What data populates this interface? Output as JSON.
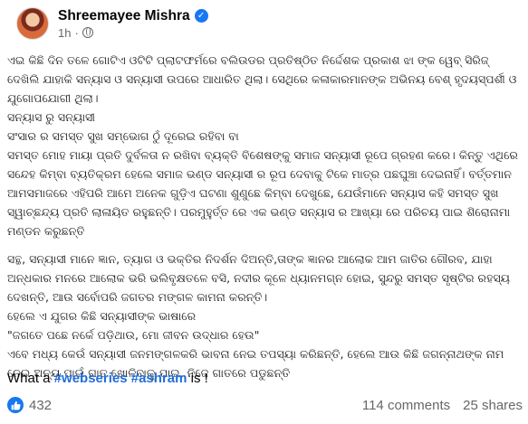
{
  "post": {
    "author": "Shreemayee Mishra",
    "time": "1h",
    "paragraphs": [
      "ଏଇ କିଛି ଦିନ ତଳେ ଗୋଟିଏ ଓଟିଟି ପ୍ଲାଟଫର୍ମରେ ବଲିଉଡର ପ୍ରତିଷ୍ଠିତ ନିର୍ଦ୍ଦେଶକ ପ୍ରକାଶ ଝା ଙ୍କ ୱେବ୍ ସିରିଜ୍ ଦେଖିଲି ଯାହାକି ସନ୍ୟାସ ଓ ସନ୍ୟାସୀ ଉପରେ ଆଧାରିତ ଥିଲା। ସେଥିରେ କଳାକାରମାନଙ୍କ ଅଭିନୟ ବେଶ୍ ହୃଦୟସ୍ପର୍ଶୀ ଓ ଯୁଗୋପଯୋଗୀ ଥିଲା।\nସନ୍ୟାସ ରୁ ସନ୍ୟାସୀ\nସଂସାର ର ସମସ୍ତ ସୁଖ ସମ୍ଭୋଗ ଠୁଁ ଦୂରେଇ ରହିବା ବା\nସମସ୍ତ ମୋହ ମାୟା ପ୍ରତି ଦୁର୍ବଳତା ନ ରଖିବା ବ୍ୟକ୍ତି ବିଶେଷଙ୍କୁ ସମାଜ ସନ୍ୟାସୀ ରୂପେ ଗ୍ରହଣ କରେ। କିନ୍ତୁ ଏଥିରେ ସନ୍ଦେହ କିମ୍ବା ବ୍ୟତିକ୍ରମ ହେଲେ ସମାଜ ଭଣ୍ଡ ସନ୍ୟାସୀ ର ରୂପ ଦେବାକୁ ଟିକେ ମାତ୍ର ପଛଘୁଞ୍ଚା ଦେଇନାହିଁ। ବର୍ତ୍ତମାନ ଆମସମାଜରେ ଏହିପରି ଆମେ ଅନେକ ଗୁଡ଼ିଏ ଘଟଣା ଶୁଣୁଛେ କିମ୍ବା ଦେଖୁଛେ, ଯେଉଁମାନେ ସନ୍ୟାସ କହି ସମସ୍ତ ସୁଖ ସ୍ୱାଚ୍ଛନ୍ଦ୍ୟ ପ୍ରତି ଲାଳାୟିତ ରହୁଛନ୍ତି। ପରମୁହୁର୍ତ୍ତ ରେ ଏକ ଭଣ୍ଡ ସନ୍ୟାସ ର ଆଖ୍ୟା ରେ ପରିଚୟ ପାଇ ଶିରୋନାମା ମଣ୍ଡନ କରୁଛନ୍ତି",
      "ସନ୍ଥ, ସନ୍ୟାସୀ ମାନେ ଜ୍ଞାନ, ତ୍ୟାଗ ଓ ଭକ୍ତିର ନିଦର୍ଶନ ଦିଅନ୍ତି,ତାଙ୍କ ଜ୍ଞାନର ଆଲୋକ ଆମ ଜାତିର ଗୌରବ, ଯାହା ଅନ୍ଧକାର ମନରେ ଆଲୋକ ଭରି ଭଲିବୃକ୍ଷତଳେ ବସି, ନଦୀର କୂଳେ ଧ୍ୟାନମଗ୍ନ ହୋଇ, ସୁନ୍ଦରୁ ସମସ୍ତ ସୃଷ୍ଟିର ରହସ୍ୟ ଦେଖନ୍ତି, ଆଉ ସର୍ବୋପରି ଜଗତର ମଙ୍ଗଳ କାମନା କରନ୍ତି।\nହେଲେ ଏ ଯୁଗର କିଛି ସନ୍ୟାସୀଙ୍କ ଭାଷାରେ\n\"ଜଗତେ ପଛେ ନର୍କେ ପଡ଼ିଥାଉ, ମୋ ଜୀବନ ଉଦ୍ଧାର ହେଉ\"\nଏବେ ମଧ୍ୟ କେଉଁ ସନ୍ୟାସୀ ଜନମଙ୍ଗଳକରି ଭାବନା ନେଇ ତପସ୍ୟା କରିଛନ୍ତି, ହେଲେ ଆଉ କିଛି ଜଗନ୍ନାଥଙ୍କ ନାମ ନେଇ ଅନ୍ୟ ପାଇଁ ଗାତ ଖୋଳିବାକୁ ଯାଇ, ନିଜେ ଗାତରେ ପଡୁଛନ୍ତି"
    ],
    "closing_prefix": "What a ",
    "hashtags": [
      "#webseries",
      "#ashram"
    ],
    "closing_suffix": " is !"
  },
  "footer": {
    "reactions_count": "432",
    "comments": "114 comments",
    "shares": "25 shares"
  },
  "icons": {
    "avatar": "profile-photo",
    "verified": "verified-badge-icon",
    "privacy": "globe-icon",
    "reaction": "like-icon"
  },
  "colors": {
    "accent": "#1877f2",
    "hashtag": "#216fdb",
    "secondary_text": "#65676b"
  }
}
